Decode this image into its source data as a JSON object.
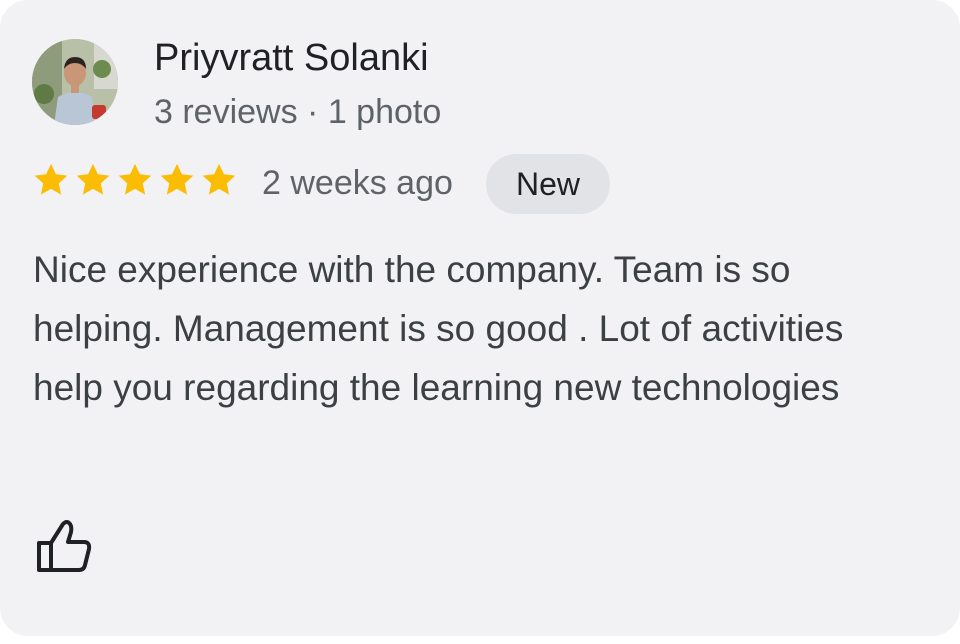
{
  "reviewer": {
    "name": "Priyvratt Solanki",
    "meta": "3 reviews · 1 photo"
  },
  "review": {
    "rating": 5,
    "rating_max": 5,
    "time": "2 weeks ago",
    "badge": "New",
    "text": "Nice experience with the company. Team is so helping. Management is so good . Lot of activities help you regarding the learning new technologies"
  },
  "icons": {
    "star": "star-icon",
    "like": "thumbs-up-icon"
  },
  "colors": {
    "star": "#fbbc04",
    "card_background": "#f2f2f5",
    "badge_background": "#e2e3e7",
    "primary_text": "#202124",
    "secondary_text": "#5f6368"
  }
}
